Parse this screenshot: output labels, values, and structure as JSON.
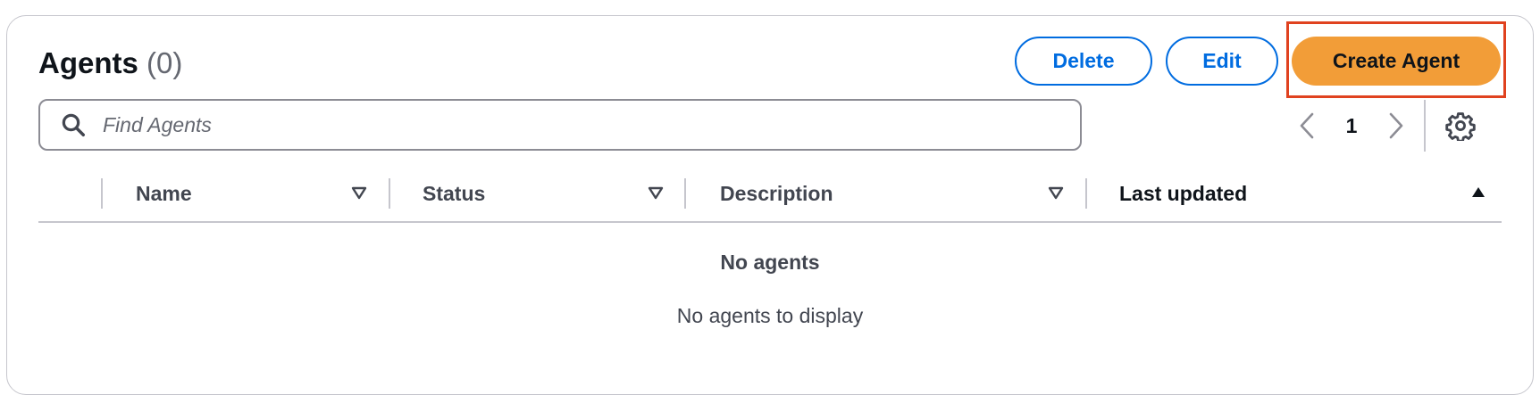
{
  "header": {
    "title": "Agents",
    "count": "(0)"
  },
  "actions": {
    "delete_label": "Delete",
    "edit_label": "Edit",
    "create_label": "Create Agent"
  },
  "search": {
    "placeholder": "Find Agents",
    "value": "",
    "icon": "search-icon"
  },
  "pagination": {
    "current_page": "1",
    "prev_icon": "chevron-left-icon",
    "next_icon": "chevron-right-icon",
    "settings_icon": "gear-icon"
  },
  "table": {
    "columns": [
      {
        "label": "Name",
        "sort": "none"
      },
      {
        "label": "Status",
        "sort": "none"
      },
      {
        "label": "Description",
        "sort": "none"
      },
      {
        "label": "Last updated",
        "sort": "ascending"
      }
    ],
    "rows": [],
    "empty_title": "No agents",
    "empty_message": "No agents to display"
  },
  "colors": {
    "primary_button": "#f29d38",
    "link_blue": "#006ce0",
    "highlight_border": "#e0421f",
    "border_gray": "#c6c6cd"
  }
}
